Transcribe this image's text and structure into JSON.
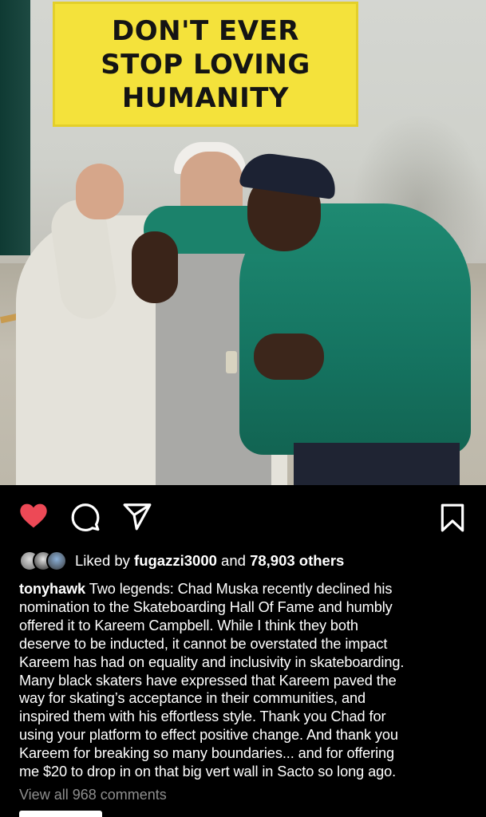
{
  "photo": {
    "sign_lines": [
      "DON'T EVER",
      "STOP LOVING",
      "HUMANITY"
    ]
  },
  "actions": {
    "like_icon": "heart-filled-icon",
    "comment_icon": "comment-bubble-icon",
    "share_icon": "paper-plane-icon",
    "save_icon": "bookmark-icon",
    "like_color": "#ed4956"
  },
  "likes": {
    "prefix": "Liked by ",
    "user": "fugazzi3000",
    "suffix": " and ",
    "others": "78,903 others"
  },
  "caption": {
    "username": "tonyhawk",
    "lines": [
      " Two legends: Chad Muska recently declined his",
      "nomination to the Skateboarding Hall Of Fame and humbly",
      "offered it to Kareem Campbell. While I think they both",
      "deserve to be inducted, it cannot be overstated the impact",
      "Kareem has had on equality and inclusivity in skateboarding.",
      "Many black skaters have expressed that Kareem paved the",
      "way for skating’s acceptance in their communities, and",
      "inspired them with his effortless style. Thank you Chad for",
      "using your platform to effect positive change. And thank you",
      "Kareem for breaking so many boundaries... and for offering",
      "me $20 to drop in on that big vert wall in Sacto so long ago."
    ]
  },
  "comments": {
    "view_all": "View all 968 comments"
  }
}
